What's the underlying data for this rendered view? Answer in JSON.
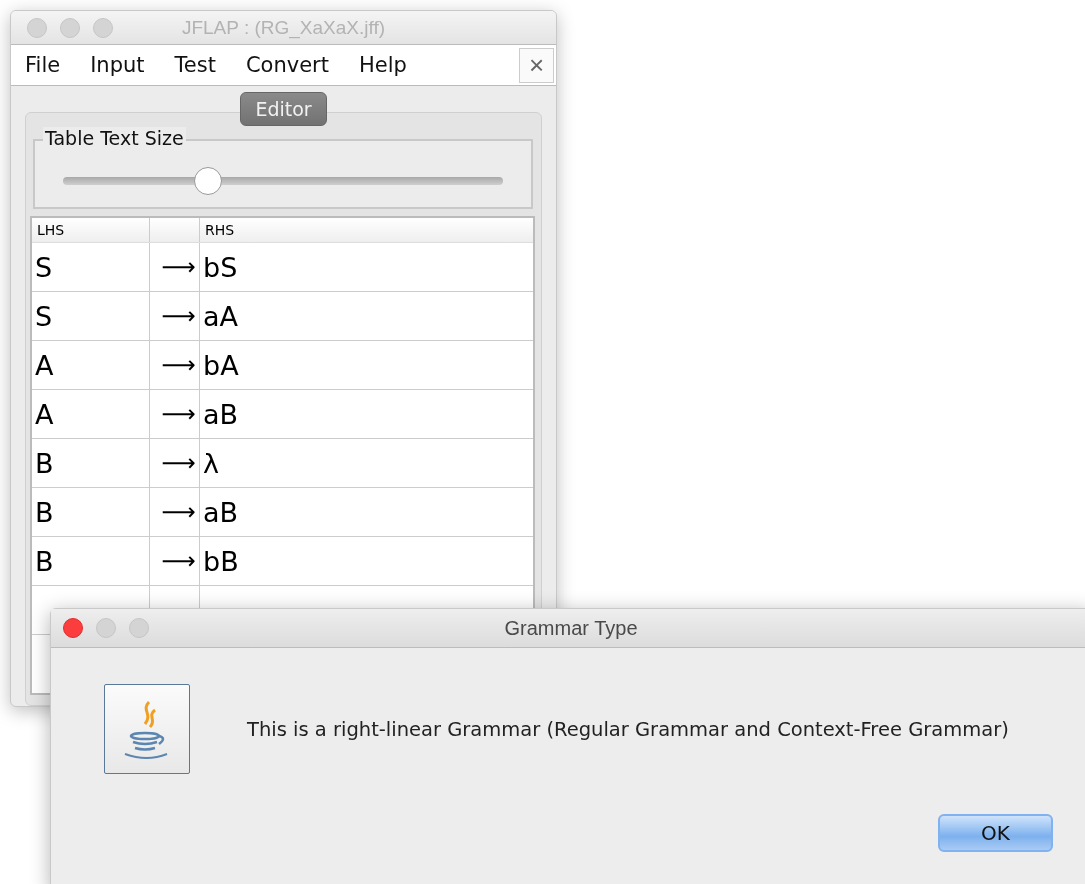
{
  "window": {
    "title": "JFLAP : (RG_XaXaX.jff)",
    "active": false
  },
  "menu": [
    "File",
    "Input",
    "Test",
    "Convert",
    "Help"
  ],
  "close_button": "×",
  "tabs": [
    {
      "label": "Editor",
      "selected": true
    }
  ],
  "text_size": {
    "label": "Table Text Size",
    "level": 0.33
  },
  "table": {
    "columns": [
      "LHS",
      "",
      "RHS"
    ],
    "rows": [
      {
        "lhs": "S",
        "arrow": "⟶",
        "rhs": "bS"
      },
      {
        "lhs": "S",
        "arrow": "⟶",
        "rhs": "aA"
      },
      {
        "lhs": "A",
        "arrow": "⟶",
        "rhs": "bA"
      },
      {
        "lhs": "A",
        "arrow": "⟶",
        "rhs": "aB"
      },
      {
        "lhs": "B",
        "arrow": "⟶",
        "rhs": "λ"
      },
      {
        "lhs": "B",
        "arrow": "⟶",
        "rhs": "aB"
      },
      {
        "lhs": "B",
        "arrow": "⟶",
        "rhs": "bB"
      },
      {
        "lhs": "",
        "arrow": "",
        "rhs": ""
      }
    ]
  },
  "dialog": {
    "title": "Grammar Type",
    "active": true,
    "message": "This is a right-linear Grammar (Regular Grammar and Context-Free Grammar)",
    "buttons": [
      "OK"
    ]
  }
}
